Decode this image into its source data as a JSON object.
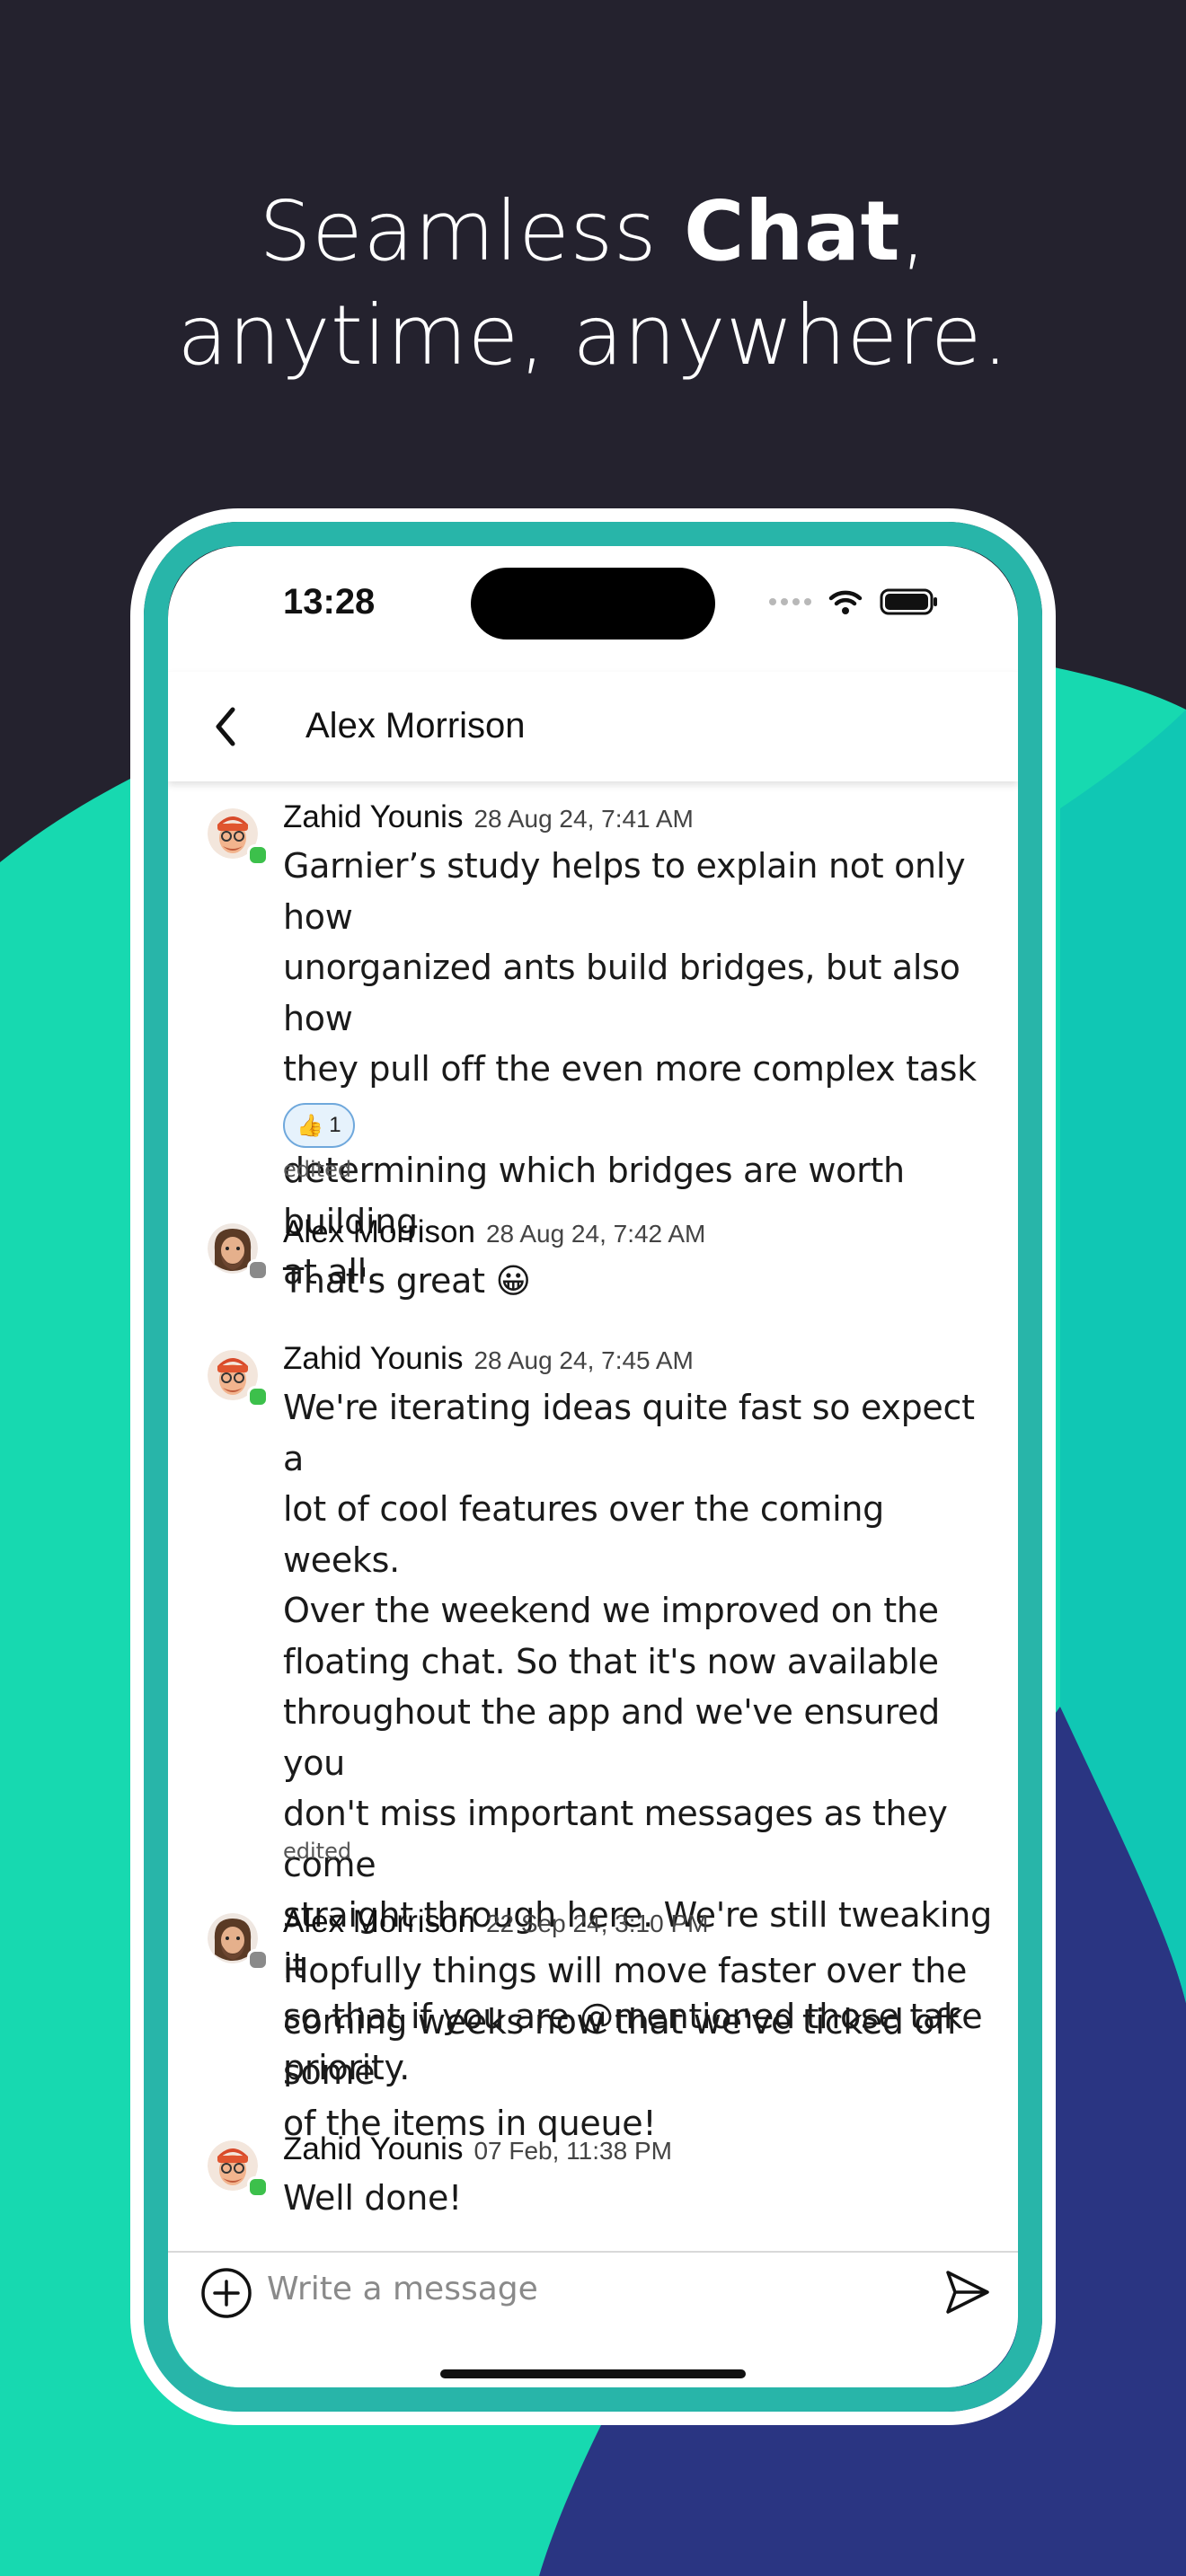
{
  "promo": {
    "headline_part1": "Seamless ",
    "headline_bold": "Chat",
    "headline_comma": ",",
    "headline_line2": "anytime, anywhere."
  },
  "colors": {
    "teal": "#17d9b0",
    "navy": "#2a3582",
    "dark": "#24222e"
  },
  "status_bar": {
    "time": "13:28"
  },
  "header": {
    "title": "Alex Morrison",
    "back_icon": "chevron-left-icon"
  },
  "messages": [
    {
      "author": "Zahid Younis",
      "timestamp": "28 Aug 24, 7:41 AM",
      "status": "online",
      "lines": [
        "Garnier’s study helps to explain not only how",
        "unorganized ants build bridges, but also how",
        "they pull off the even more complex task of",
        "determining which bridges are worth building",
        "at all."
      ],
      "reaction": {
        "emoji": "👍",
        "count": "1"
      },
      "edited": "edited"
    },
    {
      "author": "Alex Morrison",
      "timestamp": "28 Aug 24, 7:42 AM",
      "status": "offline",
      "lines": [
        "That's great 😀"
      ]
    },
    {
      "author": "Zahid Younis",
      "timestamp": "28 Aug 24, 7:45 AM",
      "status": "online",
      "lines": [
        "We're iterating ideas quite fast so expect a",
        "lot of cool features over the coming weeks.",
        "Over the weekend we improved on the",
        "floating chat. So that it's now available",
        "throughout the app and we've ensured you",
        "don't miss important messages as they come",
        "straight through here. We're still tweaking it",
        "so that if you are @mentioned those take",
        "priority."
      ],
      "edited": "edited"
    },
    {
      "author": "Alex Morrison",
      "timestamp": "22 Sep 24, 3:10 PM",
      "status": "offline",
      "lines": [
        "Hopfully things will move faster over the",
        "coming weeks now that we've ticked off some",
        "of the items in queue!"
      ]
    },
    {
      "author": "Zahid Younis",
      "timestamp": "07 Feb, 11:38 PM",
      "status": "online",
      "lines": [
        "Well done!"
      ]
    }
  ],
  "composer": {
    "placeholder": "Write a message",
    "add_icon": "plus-circle-icon",
    "send_icon": "send-icon"
  }
}
